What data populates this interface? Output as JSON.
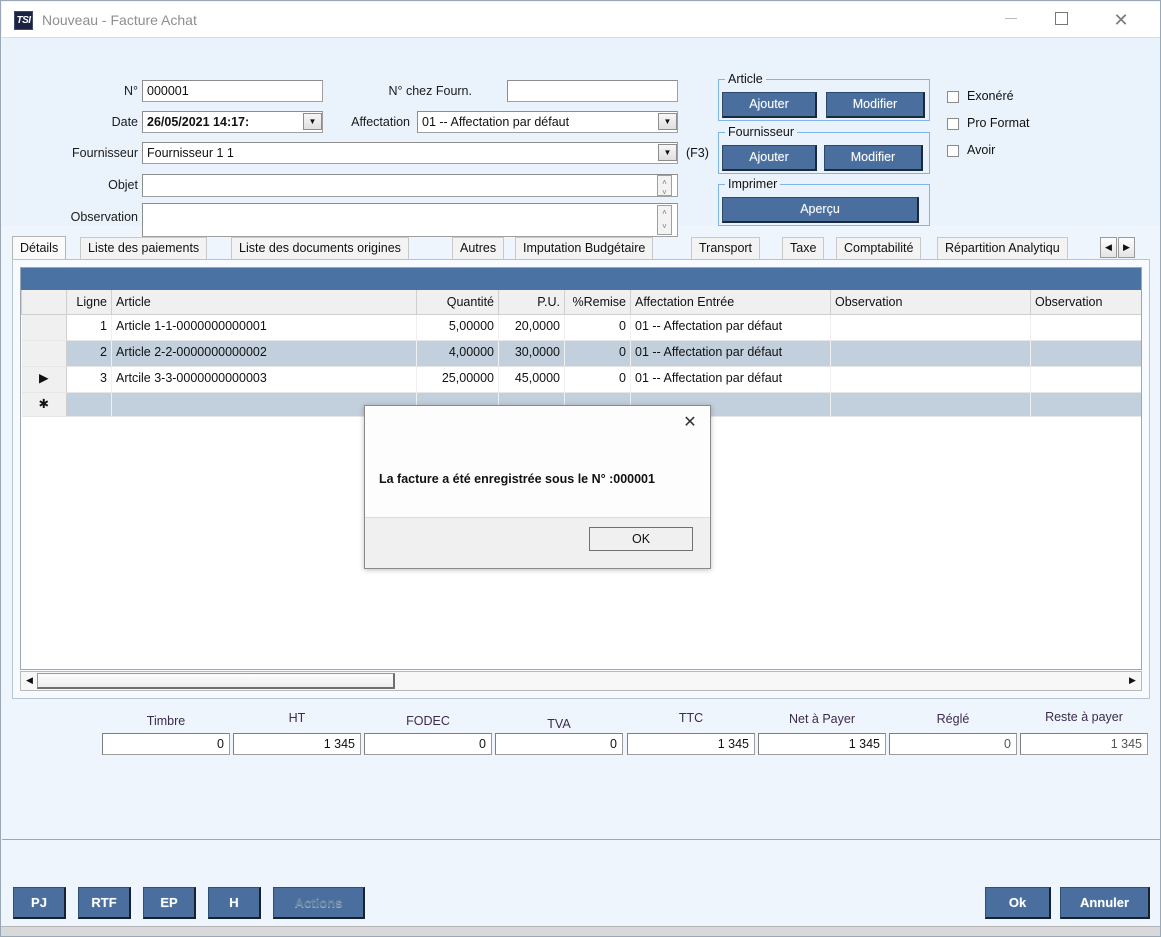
{
  "window": {
    "icon_label": "TSI",
    "title": "Nouveau - Facture Achat",
    "minimize": "—",
    "maximize": "□",
    "close": "✕"
  },
  "form": {
    "num_label": "N°",
    "num_value": "000001",
    "num_fourn_label": "N° chez Fourn.",
    "num_fourn_value": "",
    "date_label": "Date",
    "date_value": "26/05/2021 14:17:",
    "affectation_label": "Affectation",
    "affectation_value": "01 -- Affectation par défaut",
    "fournisseur_label": "Fournisseur",
    "fournisseur_value": "Fournisseur 1 1",
    "f3_hint": "(F3)",
    "objet_label": "Objet",
    "objet_value": "",
    "observation_label": "Observation",
    "observation_value": ""
  },
  "groups": {
    "article": {
      "caption": "Article",
      "add": "Ajouter",
      "edit": "Modifier"
    },
    "fournisseur": {
      "caption": "Fournisseur",
      "add": "Ajouter",
      "edit": "Modifier"
    },
    "imprimer": {
      "caption": "Imprimer",
      "preview": "Aperçu"
    }
  },
  "checkboxes": [
    {
      "label": "Exonéré",
      "checked": false
    },
    {
      "label": "Pro Format",
      "checked": false
    },
    {
      "label": "Avoir",
      "checked": false
    }
  ],
  "tabs": [
    {
      "label": "Détails",
      "active": true
    },
    {
      "label": "Liste des paiements",
      "active": false
    },
    {
      "label": "Liste des documents origines",
      "active": false
    },
    {
      "label": "Autres",
      "active": false
    },
    {
      "label": "Imputation Budgétaire",
      "active": false
    },
    {
      "label": "Transport",
      "active": false
    },
    {
      "label": "Taxe",
      "active": false
    },
    {
      "label": "Comptabilité",
      "active": false
    },
    {
      "label": "Répartition Analytiqu",
      "active": false
    }
  ],
  "tab_scroll": {
    "left": "◀",
    "right": "▶"
  },
  "grid": {
    "columns": [
      "Ligne",
      "Article",
      "Quantité",
      "P.U.",
      "%Remise",
      "Affectation Entrée",
      "Observation",
      "Observation"
    ],
    "rows": [
      {
        "selector": "",
        "ligne": "1",
        "article": "Article 1-1-0000000000001",
        "quantite": "5,00000",
        "pu": "20,0000",
        "remise": "0",
        "affectation": "01 -- Affectation par défaut",
        "observation1": "",
        "observation2": ""
      },
      {
        "selector": "",
        "ligne": "2",
        "article": "Article 2-2-0000000000002",
        "quantite": "4,00000",
        "pu": "30,0000",
        "remise": "0",
        "affectation": "01 -- Affectation par défaut",
        "observation1": "",
        "observation2": ""
      },
      {
        "selector": "▶",
        "ligne": "3",
        "article": "Artcile 3-3-0000000000003",
        "quantite": "25,00000",
        "pu": "45,0000",
        "remise": "0",
        "affectation": "01 -- Affectation par défaut",
        "observation1": "",
        "observation2": ""
      }
    ],
    "new_row_marker": "✱",
    "hscroll": {
      "left": "◀",
      "right": "▶"
    }
  },
  "totals": [
    {
      "label": "Timbre",
      "value": "0",
      "readonly": false
    },
    {
      "label": "HT",
      "value": "1 345",
      "readonly": false
    },
    {
      "label": "FODEC",
      "value": "0",
      "readonly": false
    },
    {
      "label": "TVA",
      "value": "0",
      "readonly": false
    },
    {
      "label": "TTC",
      "value": "1 345",
      "readonly": false
    },
    {
      "label": "Net à Payer",
      "value": "1 345",
      "readonly": false
    },
    {
      "label": "Réglé",
      "value": "0",
      "readonly": true
    },
    {
      "label": "Reste à payer",
      "value": "1 345",
      "readonly": true
    }
  ],
  "dialog": {
    "message": "La facture a été enregistrée sous le N° :000001",
    "ok": "OK",
    "close": "✕"
  },
  "footer": {
    "left_buttons": [
      {
        "label": "PJ",
        "disabled": false
      },
      {
        "label": "RTF",
        "disabled": false
      },
      {
        "label": "EP",
        "disabled": false
      },
      {
        "label": "H",
        "disabled": false
      },
      {
        "label": "Actions",
        "disabled": true
      }
    ],
    "ok": "Ok",
    "cancel": "Annuler"
  },
  "colors": {
    "accent_blue": "#4a6f9e",
    "grid_caption": "#4a72a3",
    "form_bg": "#eaf2fb",
    "panel_bg": "#eef5fc",
    "alt_row": "#c2cfdc",
    "separator": "#6fb3e8",
    "total_label": "#3d2b4e"
  }
}
